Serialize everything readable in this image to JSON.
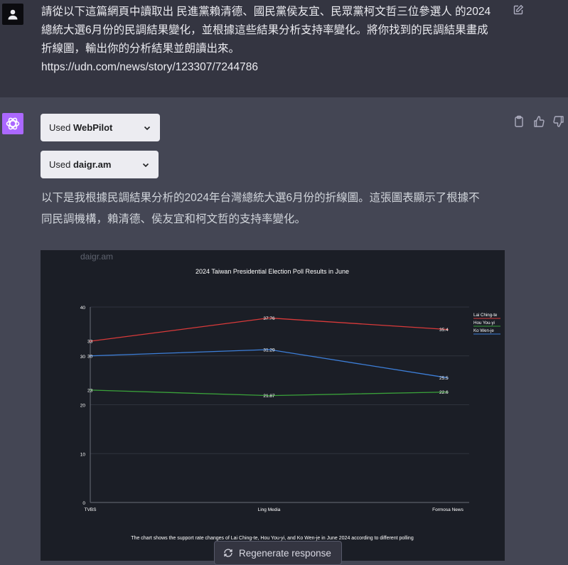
{
  "user_message": {
    "lines": [
      "請從以下這篇網頁中讀取出 民進黨賴清德、國民黨侯友宜、民眾黨柯文哲三位參選人 的2024",
      "總統大選6月份的民調結果變化，並根據這些結果分析支持率變化。將你找到的民調結果畫成",
      "折線圖，輸出你的分析結果並朗讀出來。",
      "https://udn.com/news/story/123307/7244786"
    ]
  },
  "plugins": [
    {
      "prefix": "Used",
      "name": "WebPilot"
    },
    {
      "prefix": "Used",
      "name": "daigr.am"
    }
  ],
  "answer": {
    "lines": [
      "以下是我根據民調結果分析的2024年台灣總統大選6月份的折線圖。這張圖表顯示了根據不",
      "同民調機構，賴清德、侯友宜和柯文哲的支持率變化。"
    ]
  },
  "chart": {
    "watermark": "daigr.am",
    "caption": "The chart shows the support rate changes of Lai Ching-te, Hou You-yi, and Ko Wen-je in June 2024 according to different polling"
  },
  "chart_data": {
    "type": "line",
    "title": "2024 Taiwan Presidential Election Poll Results in June",
    "categories": [
      "TVBS",
      "Ling Media",
      "Formosa News"
    ],
    "series": [
      {
        "name": "Lai Ching-te",
        "values": [
          33,
          37.76,
          35.4
        ],
        "color": "#d93a3a",
        "labels": [
          "33",
          "37.76",
          "35.4"
        ]
      },
      {
        "name": "Hou You-yi",
        "values": [
          23,
          21.87,
          22.6
        ],
        "color": "#3aa13a",
        "labels": [
          "23",
          "21.87",
          "22.6"
        ]
      },
      {
        "name": "Ko Wen-je",
        "values": [
          30,
          31.29,
          25.5
        ],
        "color": "#3d7fd9",
        "labels": [
          "30",
          "31.29",
          "25.5"
        ]
      }
    ],
    "ylim": [
      0,
      40
    ],
    "yticks": [
      0,
      10,
      20,
      30,
      40
    ],
    "legend": "top-right",
    "grid": true
  },
  "buttons": {
    "regenerate": "Regenerate response"
  },
  "icons": {
    "user_avatar": "user-icon",
    "assistant_avatar": "openai-logo-icon",
    "edit": "edit-icon",
    "copy": "clipboard-icon",
    "like": "thumbs-up-icon",
    "dislike": "thumbs-down-icon",
    "regenerate": "refresh-icon",
    "dropdown": "chevron-down-icon"
  }
}
